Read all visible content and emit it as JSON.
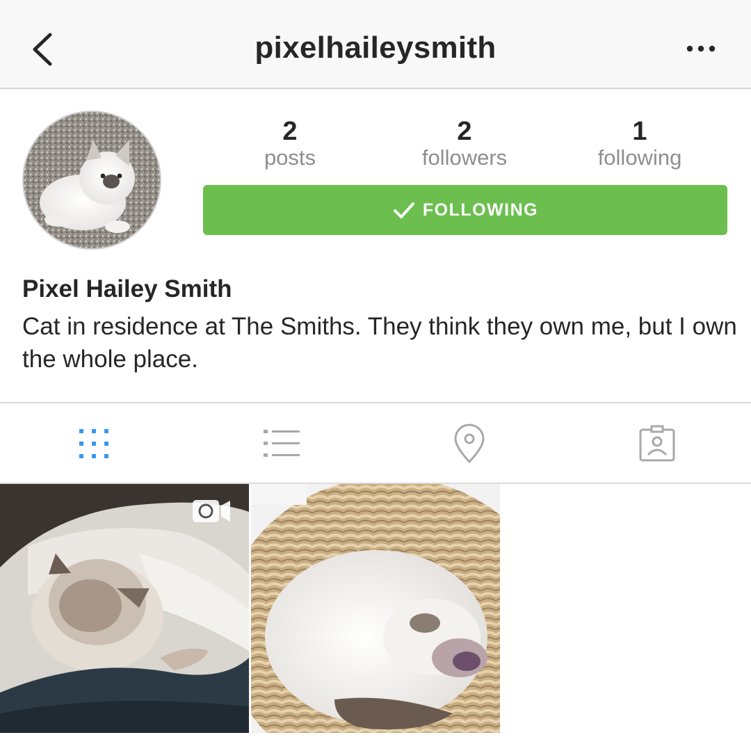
{
  "nav": {
    "username": "pixelhaileysmith",
    "back_icon": "chevron-left-icon",
    "more_icon": "more-horizontal-icon"
  },
  "profile": {
    "stats": [
      {
        "count": "2",
        "label": "posts"
      },
      {
        "count": "2",
        "label": "followers"
      },
      {
        "count": "1",
        "label": "following"
      }
    ],
    "follow_button": {
      "label": "FOLLOWING",
      "icon": "checkmark-icon",
      "color": "#6cbf4f"
    },
    "display_name": "Pixel Hailey Smith",
    "bio": "Cat in residence at The Smiths. They think they own me, but I own the whole place."
  },
  "tabs": [
    {
      "name": "grid-view",
      "icon": "grid-icon",
      "active": true,
      "color": "#3897f0"
    },
    {
      "name": "list-view",
      "icon": "list-icon",
      "active": false
    },
    {
      "name": "places",
      "icon": "location-pin-icon",
      "active": false
    },
    {
      "name": "tagged",
      "icon": "tagged-person-icon",
      "active": false
    }
  ],
  "posts": [
    {
      "subject": "kitten on blanket",
      "type": "video",
      "badge_icon": "video-camera-icon"
    },
    {
      "subject": "kitten curled in wicker basket",
      "type": "photo"
    }
  ],
  "colors": {
    "accent": "#3897f0",
    "follow_green": "#6cbf4f",
    "muted_text": "#8e8e8e",
    "text": "#262626"
  }
}
